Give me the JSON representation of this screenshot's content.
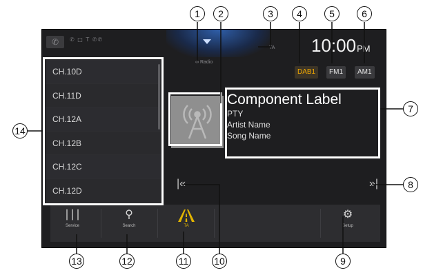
{
  "status_bar": {
    "phone_icon": "phone-icon",
    "status_icons_text": "✆ □ T ✆✆",
    "source_name": "Radio",
    "ta_indicator": "TA",
    "clock": {
      "time": "10:00",
      "ampm": "PM"
    }
  },
  "bands": [
    {
      "label": "DAB1",
      "active": true
    },
    {
      "label": "FM1",
      "active": false
    },
    {
      "label": "AM1",
      "active": false
    }
  ],
  "channel_list": [
    "CH.10D",
    "CH.11D",
    "CH.12A",
    "CH.12B",
    "CH.12C",
    "CH.12D"
  ],
  "now_playing": {
    "component_label": "Component Label",
    "pty": "PTY",
    "artist": "Artist Name",
    "song": "Song Name"
  },
  "transport": {
    "prev_icon": "seek-back-icon",
    "next_icon": "seek-forward-icon"
  },
  "bottom_bar": {
    "service": "Service",
    "search": "Search",
    "ta": "TA",
    "setup": "Setup"
  },
  "callout_numbers": [
    "1",
    "2",
    "3",
    "4",
    "5",
    "6",
    "7",
    "8",
    "9",
    "10",
    "11",
    "12",
    "13",
    "14"
  ],
  "colors": {
    "accent_amber": "#f2a900",
    "screen_bg": "#1e1e20"
  }
}
